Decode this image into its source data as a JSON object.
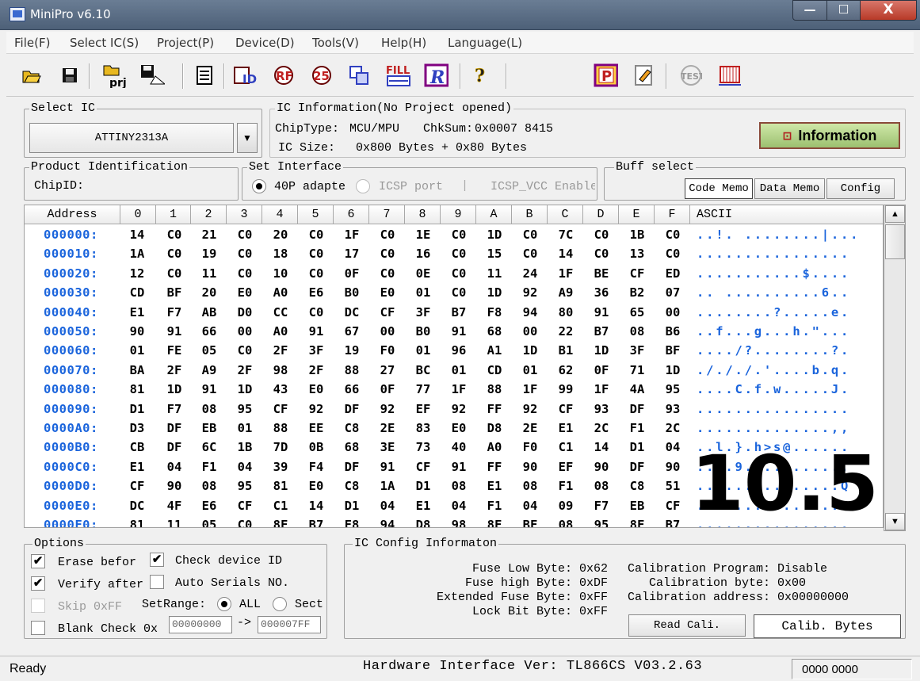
{
  "window": {
    "title": "MiniPro v6.10"
  },
  "menu": [
    "File(F)",
    "Select IC(S)",
    "Project(P)",
    "Device(D)",
    "Tools(V)",
    "Help(H)",
    "Language(L)"
  ],
  "toolbar": {
    "icons": [
      "open-icon",
      "save-icon",
      "project-icon",
      "save-project-icon",
      "chip-icon",
      "read-id-icon",
      "read-icon",
      "blank-check-icon",
      "verify-icon",
      "fill-icon",
      "program-r-icon",
      "help-icon",
      "program-p-icon",
      "edit-icon",
      "test-icon",
      "chip-test-icon"
    ],
    "prj_label": "prj",
    "fill_label": "FILL",
    "id_label": "ID",
    "r_label": "R",
    "p_label": "P",
    "help_label": "?",
    "test_label": "TEST"
  },
  "select_ic": {
    "label": "Select IC",
    "value": "ATTINY2313A"
  },
  "ic_info": {
    "label": "IC Information(No Project opened)",
    "chip_type_label": "ChipType:",
    "chip_type": "MCU/MPU",
    "checksum_label": "ChkSum:",
    "checksum": "0x0007 8415",
    "ic_size_label": "IC Size:",
    "ic_size": "0x800 Bytes + 0x80 Bytes",
    "info_button": "Information"
  },
  "product_id": {
    "label": "Product Identification",
    "chip_id_label": "ChipID:"
  },
  "interface": {
    "label": "Set Interface",
    "opt1": "40P adapte",
    "opt2": "ICSP port",
    "opt3": "ICSP_VCC Enable"
  },
  "buff": {
    "label": "Buff select",
    "tabs": [
      "Code Memo",
      "Data Memo",
      "Config"
    ]
  },
  "grid": {
    "columns": [
      "Address",
      "0",
      "1",
      "2",
      "3",
      "4",
      "5",
      "6",
      "7",
      "8",
      "9",
      "A",
      "B",
      "C",
      "D",
      "E",
      "F",
      "ASCII"
    ],
    "rows": [
      {
        "addr": "000000:",
        "bytes": [
          "14",
          "C0",
          "21",
          "C0",
          "20",
          "C0",
          "1F",
          "C0",
          "1E",
          "C0",
          "1D",
          "C0",
          "7C",
          "C0",
          "1B",
          "C0"
        ],
        "ascii": "..!. ........|..."
      },
      {
        "addr": "000010:",
        "bytes": [
          "1A",
          "C0",
          "19",
          "C0",
          "18",
          "C0",
          "17",
          "C0",
          "16",
          "C0",
          "15",
          "C0",
          "14",
          "C0",
          "13",
          "C0"
        ],
        "ascii": "................"
      },
      {
        "addr": "000020:",
        "bytes": [
          "12",
          "C0",
          "11",
          "C0",
          "10",
          "C0",
          "0F",
          "C0",
          "0E",
          "C0",
          "11",
          "24",
          "1F",
          "BE",
          "CF",
          "ED"
        ],
        "ascii": "...........$...."
      },
      {
        "addr": "000030:",
        "bytes": [
          "CD",
          "BF",
          "20",
          "E0",
          "A0",
          "E6",
          "B0",
          "E0",
          "01",
          "C0",
          "1D",
          "92",
          "A9",
          "36",
          "B2",
          "07"
        ],
        "ascii": ".. ..........6.."
      },
      {
        "addr": "000040:",
        "bytes": [
          "E1",
          "F7",
          "AB",
          "D0",
          "CC",
          "C0",
          "DC",
          "CF",
          "3F",
          "B7",
          "F8",
          "94",
          "80",
          "91",
          "65",
          "00"
        ],
        "ascii": "........?.....e."
      },
      {
        "addr": "000050:",
        "bytes": [
          "90",
          "91",
          "66",
          "00",
          "A0",
          "91",
          "67",
          "00",
          "B0",
          "91",
          "68",
          "00",
          "22",
          "B7",
          "08",
          "B6"
        ],
        "ascii": "..f...g...h.\"..."
      },
      {
        "addr": "000060:",
        "bytes": [
          "01",
          "FE",
          "05",
          "C0",
          "2F",
          "3F",
          "19",
          "F0",
          "01",
          "96",
          "A1",
          "1D",
          "B1",
          "1D",
          "3F",
          "BF"
        ],
        "ascii": "..../?........?."
      },
      {
        "addr": "000070:",
        "bytes": [
          "BA",
          "2F",
          "A9",
          "2F",
          "98",
          "2F",
          "88",
          "27",
          "BC",
          "01",
          "CD",
          "01",
          "62",
          "0F",
          "71",
          "1D"
        ],
        "ascii": "./././.'....b.q."
      },
      {
        "addr": "000080:",
        "bytes": [
          "81",
          "1D",
          "91",
          "1D",
          "43",
          "E0",
          "66",
          "0F",
          "77",
          "1F",
          "88",
          "1F",
          "99",
          "1F",
          "4A",
          "95"
        ],
        "ascii": "....C.f.w.....J."
      },
      {
        "addr": "000090:",
        "bytes": [
          "D1",
          "F7",
          "08",
          "95",
          "CF",
          "92",
          "DF",
          "92",
          "EF",
          "92",
          "FF",
          "92",
          "CF",
          "93",
          "DF",
          "93"
        ],
        "ascii": "................"
      },
      {
        "addr": "0000A0:",
        "bytes": [
          "D3",
          "DF",
          "EB",
          "01",
          "88",
          "EE",
          "C8",
          "2E",
          "83",
          "E0",
          "D8",
          "2E",
          "E1",
          "2C",
          "F1",
          "2C"
        ],
        "ascii": "..............,,"
      },
      {
        "addr": "0000B0:",
        "bytes": [
          "CB",
          "DF",
          "6C",
          "1B",
          "7D",
          "0B",
          "68",
          "3E",
          "73",
          "40",
          "A0",
          "F0",
          "C1",
          "14",
          "D1",
          "04"
        ],
        "ascii": "..l.}.h>s@......"
      },
      {
        "addr": "0000C0:",
        "bytes": [
          "E1",
          "04",
          "F1",
          "04",
          "39",
          "F4",
          "DF",
          "91",
          "CF",
          "91",
          "FF",
          "90",
          "EF",
          "90",
          "DF",
          "90"
        ],
        "ascii": "....9..........."
      },
      {
        "addr": "0000D0:",
        "bytes": [
          "CF",
          "90",
          "08",
          "95",
          "81",
          "E0",
          "C8",
          "1A",
          "D1",
          "08",
          "E1",
          "08",
          "F1",
          "08",
          "C8",
          "51"
        ],
        "ascii": "...............Q"
      },
      {
        "addr": "0000E0:",
        "bytes": [
          "DC",
          "4F",
          "E6",
          "CF",
          "C1",
          "14",
          "D1",
          "04",
          "E1",
          "04",
          "F1",
          "04",
          "09",
          "F7",
          "EB",
          "CF"
        ],
        "ascii": ".O.............."
      },
      {
        "addr": "0000F0:",
        "bytes": [
          "81",
          "11",
          "05",
          "C0",
          "8F",
          "B7",
          "F8",
          "94",
          "D8",
          "98",
          "8F",
          "BF",
          "08",
          "95",
          "8F",
          "B7"
        ],
        "ascii": "................"
      }
    ]
  },
  "overlay_text": "10.5",
  "options": {
    "label": "Options",
    "erase": "Erase befor",
    "check_id": "Check device ID",
    "verify": "Verify after",
    "auto_serials": "Auto Serials NO.",
    "skip": "Skip 0xFF",
    "set_range": "SetRange:",
    "all": "ALL",
    "sect": "Sect",
    "blank_check": "Blank Check 0x",
    "range_from": "00000000",
    "arrow": "->",
    "range_to": "000007FF"
  },
  "config": {
    "label": "IC Config Informaton",
    "fuse_low_label": "Fuse Low Byte:",
    "fuse_low": "0x62",
    "fuse_high_label": "Fuse high Byte:",
    "fuse_high": "0xDF",
    "ext_fuse_label": "Extended Fuse Byte:",
    "ext_fuse": "0xFF",
    "lock_label": "Lock Bit Byte:",
    "lock": "0xFF",
    "cal_prog_label": "Calibration Program:",
    "cal_prog": "Disable",
    "cal_byte_label": "Calibration byte:",
    "cal_byte": "0x00",
    "cal_addr_label": "Calibration address:",
    "cal_addr": "0x00000000",
    "read_cali": "Read Cali.",
    "calib_bytes": "Calib. Bytes"
  },
  "status": {
    "ready": "Ready",
    "hw": "Hardware Interface Ver: TL866CS V03.2.63",
    "code": "0000 0000"
  }
}
